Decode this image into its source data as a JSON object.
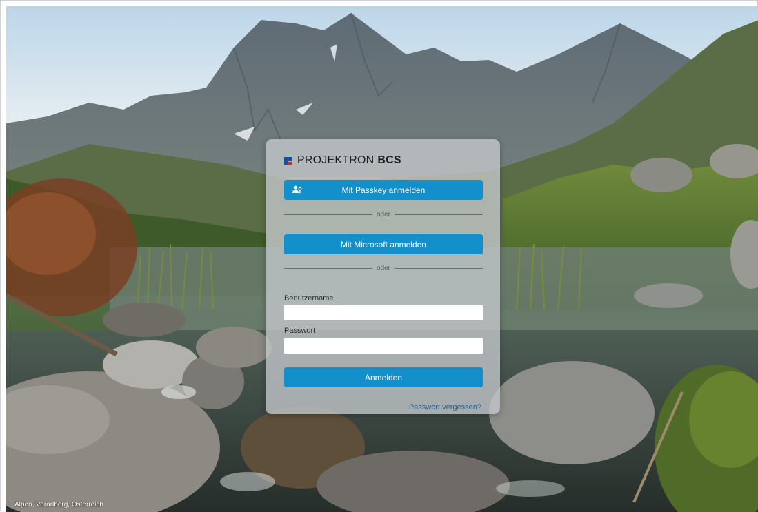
{
  "background": {
    "caption": "Alpen, Vorarlberg, Österreich"
  },
  "login": {
    "brand_name": "PROJEKTRON",
    "brand_suffix": "BCS",
    "passkey_button": "Mit Passkey anmelden",
    "separator_1": "oder",
    "microsoft_button": "Mit Microsoft anmelden",
    "separator_2": "oder",
    "username_label": "Benutzername",
    "username_value": "",
    "password_label": "Passwort",
    "password_value": "",
    "submit_button": "Anmelden",
    "forgot_link": "Passwort vergessen?"
  },
  "colors": {
    "primary_button": "#138fcc",
    "link": "#1b5f99",
    "logo_blue": "#1f4e96",
    "logo_red": "#d62b2b"
  },
  "icons": {
    "passkey": "passkey-icon",
    "logo": "projektron-logo-icon"
  }
}
